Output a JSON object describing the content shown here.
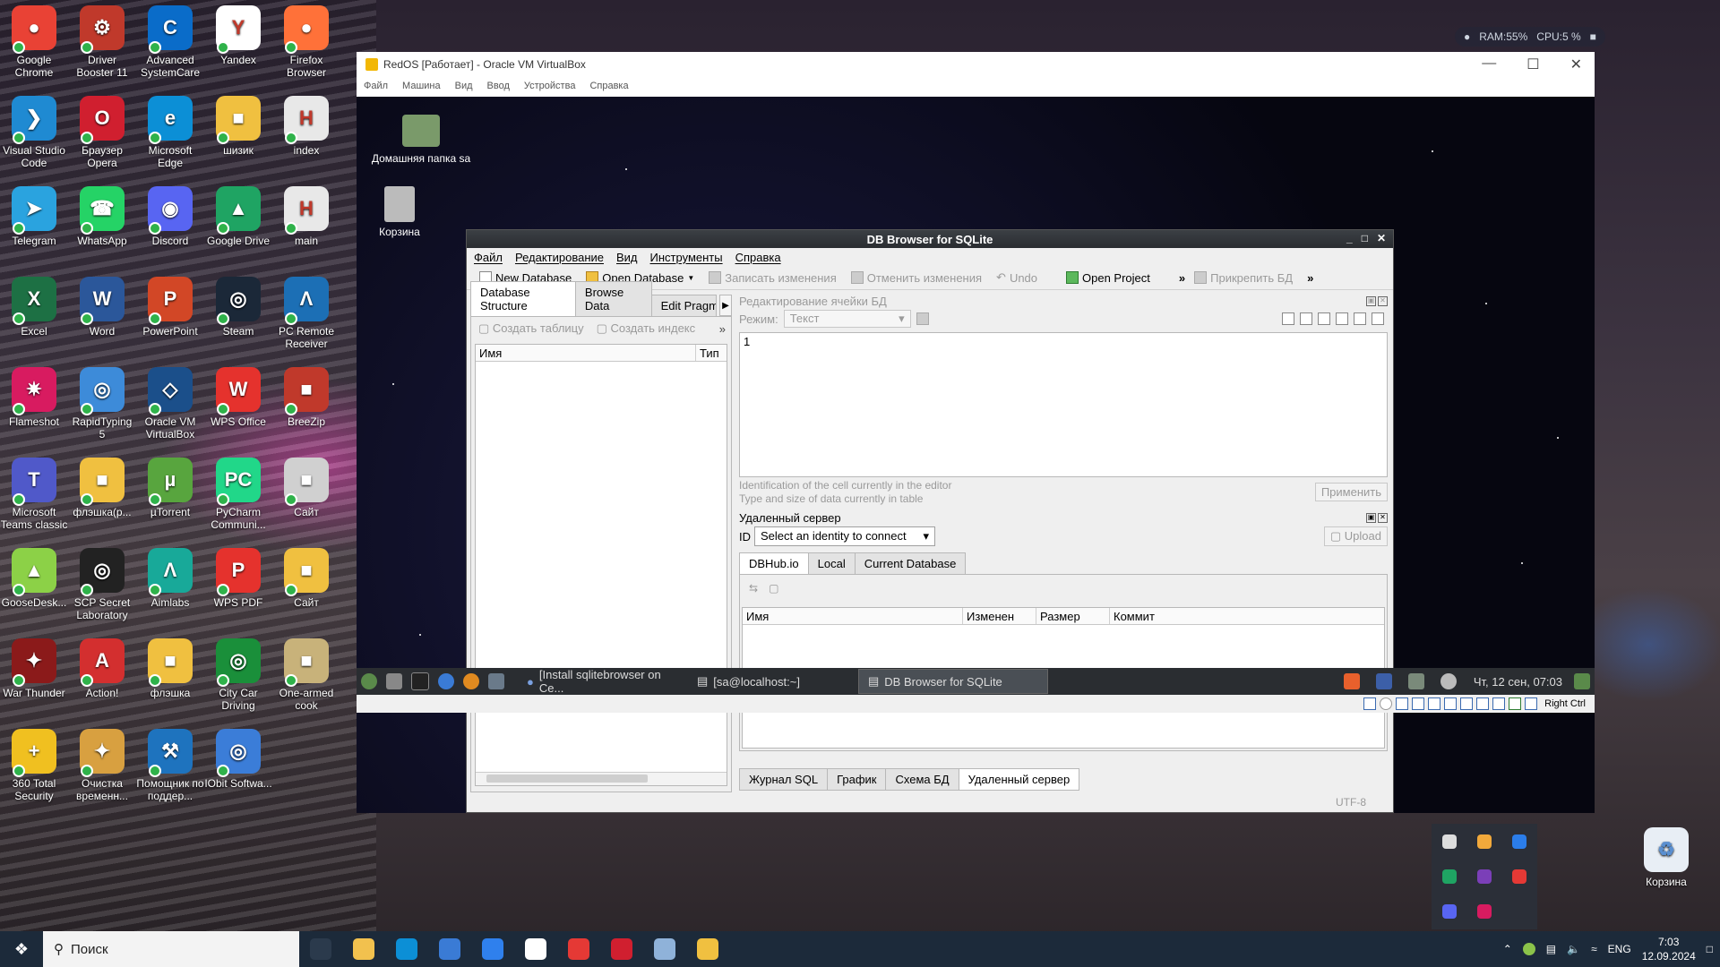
{
  "desktop": {
    "icons": [
      {
        "label": "Google Chrome",
        "color": "#e94235",
        "glyph": "●"
      },
      {
        "label": "Driver Booster 11",
        "color": "#c0392b",
        "glyph": "⚙"
      },
      {
        "label": "Advanced SystemCare",
        "color": "#0a6cc9",
        "glyph": "C"
      },
      {
        "label": "Yandex",
        "color": "#ffffff",
        "glyph": "Y"
      },
      {
        "label": "Firefox Browser",
        "color": "#ff7139",
        "glyph": "●"
      },
      {
        "label": "Visual Studio Code",
        "color": "#1f8ad2",
        "glyph": "❯"
      },
      {
        "label": "Браузер Opera",
        "color": "#d01f2f",
        "glyph": "O"
      },
      {
        "label": "Microsoft Edge",
        "color": "#0c8fd6",
        "glyph": "e"
      },
      {
        "label": "шизик",
        "color": "#f0c040",
        "glyph": "■"
      },
      {
        "label": "index",
        "color": "#e8e8e8",
        "glyph": "H"
      },
      {
        "label": "Telegram",
        "color": "#2aa3df",
        "glyph": "➤"
      },
      {
        "label": "WhatsApp",
        "color": "#25d366",
        "glyph": "☎"
      },
      {
        "label": "Discord",
        "color": "#5865f2",
        "glyph": "◉"
      },
      {
        "label": "Google Drive",
        "color": "#1fa463",
        "glyph": "▲"
      },
      {
        "label": "main",
        "color": "#e8e8e8",
        "glyph": "H"
      },
      {
        "label": "Excel",
        "color": "#1d7044",
        "glyph": "X"
      },
      {
        "label": "Word",
        "color": "#2b579a",
        "glyph": "W"
      },
      {
        "label": "PowerPoint",
        "color": "#d24726",
        "glyph": "P"
      },
      {
        "label": "Steam",
        "color": "#1b2838",
        "glyph": "◎"
      },
      {
        "label": "PC Remote Receiver",
        "color": "#1c6fb5",
        "glyph": "Λ"
      },
      {
        "label": "Flameshot",
        "color": "#d81b60",
        "glyph": "✷"
      },
      {
        "label": "RapidTyping 5",
        "color": "#3d8bd9",
        "glyph": "◎"
      },
      {
        "label": "Oracle VM VirtualBox",
        "color": "#1b4f8a",
        "glyph": "◇"
      },
      {
        "label": "WPS Office",
        "color": "#e5322d",
        "glyph": "W"
      },
      {
        "label": "BreeZip",
        "color": "#c0392b",
        "glyph": "■"
      },
      {
        "label": "Microsoft Teams classic",
        "color": "#5059c9",
        "glyph": "T"
      },
      {
        "label": "флэшка(p...",
        "color": "#f0c040",
        "glyph": "■"
      },
      {
        "label": "µTorrent",
        "color": "#58a53e",
        "glyph": "µ"
      },
      {
        "label": "PyCharm Communi...",
        "color": "#21d789",
        "glyph": "PC"
      },
      {
        "label": "Сайт",
        "color": "#d0d0d0",
        "glyph": "■"
      },
      {
        "label": "GooseDesk...",
        "color": "#8cd147",
        "glyph": "▲"
      },
      {
        "label": "SCP Secret Laboratory",
        "color": "#222222",
        "glyph": "◎"
      },
      {
        "label": "Aimlabs",
        "color": "#18a999",
        "glyph": "Λ"
      },
      {
        "label": "WPS PDF",
        "color": "#e5322d",
        "glyph": "P"
      },
      {
        "label": "Сайт",
        "color": "#f0c040",
        "glyph": "■"
      },
      {
        "label": "War Thunder",
        "color": "#8b1a1a",
        "glyph": "✦"
      },
      {
        "label": "Action!",
        "color": "#d32f2f",
        "glyph": "A"
      },
      {
        "label": "флэшка",
        "color": "#f0c040",
        "glyph": "■"
      },
      {
        "label": "City Car Driving",
        "color": "#1a8f3a",
        "glyph": "◎"
      },
      {
        "label": "One-armed cook",
        "color": "#c8b27a",
        "glyph": "■"
      },
      {
        "label": "360 Total Security",
        "color": "#f0c020",
        "glyph": "+"
      },
      {
        "label": "Очистка временн...",
        "color": "#d8a040",
        "glyph": "✦"
      },
      {
        "label": "Помощник по поддер...",
        "color": "#1e73be",
        "glyph": "⚒"
      },
      {
        "label": "IObit Softwa...",
        "color": "#3b7dd8",
        "glyph": "◎"
      }
    ],
    "recycle_right": "Корзина"
  },
  "perf": {
    "ram": "RAM:55%",
    "cpu": "CPU:5 %"
  },
  "vbox": {
    "title": "RedOS [Работает] - Oracle VM VirtualBox",
    "menu": [
      "Файл",
      "Машина",
      "Вид",
      "Ввод",
      "Устройства",
      "Справка"
    ],
    "guest_home_label": "Домашняя папка sa",
    "guest_trash_label": "Корзина",
    "status_hostkey": "Right Ctrl"
  },
  "db": {
    "title": "DB Browser for SQLite",
    "menu": [
      "Файл",
      "Редактирование",
      "Вид",
      "Инструменты",
      "Справка"
    ],
    "toolbar": {
      "new_db": "New Database",
      "open_db": "Open Database",
      "write": "Записать изменения",
      "revert": "Отменить изменения",
      "undo": "Undo",
      "open_project": "Open Project",
      "attach": "Прикрепить БД"
    },
    "left_tabs": [
      "Database Structure",
      "Browse Data",
      "Edit Pragma"
    ],
    "left_tools": {
      "create_table": "Создать таблицу",
      "create_index": "Создать индекс"
    },
    "tree_headers": {
      "name": "Имя",
      "type": "Тип"
    },
    "cell_editor": {
      "title": "Редактирование ячейки БД",
      "mode_label": "Режим:",
      "mode_value": "Текст",
      "content": "1",
      "hint1": "Identification of the cell currently in the editor",
      "hint2": "Type and size of data currently in table",
      "apply": "Применить"
    },
    "remote": {
      "title": "Удаленный сервер",
      "id_label": "ID",
      "identity": "Select an identity to connect",
      "upload": "Upload",
      "tabs": [
        "DBHub.io",
        "Local",
        "Current Database"
      ],
      "headers": [
        "Имя",
        "Изменен",
        "Размер",
        "Коммит"
      ]
    },
    "bottom_tabs": [
      "Журнал SQL",
      "График",
      "Схема БД",
      "Удаленный сервер"
    ],
    "encoding": "UTF-8"
  },
  "guest_taskbar": {
    "items": [
      "[Install sqlitebrowser on Ce...",
      "[sa@localhost:~]",
      "DB Browser for SQLite"
    ],
    "clock": "Чт, 12 сен, 07:03"
  },
  "host_taskbar": {
    "search_placeholder": "Поиск",
    "lang": "ENG",
    "time": "7:03",
    "date": "12.09.2024",
    "apps": [
      {
        "name": "task-view",
        "color": "#2b3a4c"
      },
      {
        "name": "explorer",
        "color": "#f2c14e"
      },
      {
        "name": "edge",
        "color": "#0c8fd6"
      },
      {
        "name": "store",
        "color": "#3a7bd5"
      },
      {
        "name": "mail",
        "color": "#2f80ed"
      },
      {
        "name": "yandex",
        "color": "#ffffff"
      },
      {
        "name": "yandex-browser",
        "color": "#e53935"
      },
      {
        "name": "opera",
        "color": "#d01f2f"
      },
      {
        "name": "virtualbox",
        "color": "#8fb2d9"
      },
      {
        "name": "folder-sqlite",
        "color": "#f0c040"
      }
    ]
  }
}
